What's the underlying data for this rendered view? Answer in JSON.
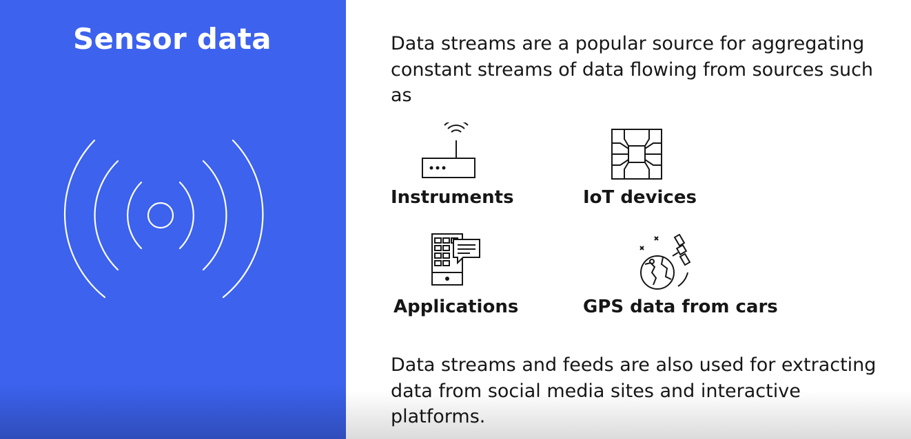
{
  "left_panel": {
    "title": "Sensor data",
    "icon": "sensor-signal-icon",
    "background_color": "#3c62ee"
  },
  "right_panel": {
    "intro_text": "Data streams are a popular source for aggregating constant streams of data flowing from sources such as",
    "sources": [
      {
        "label": "Instruments",
        "icon": "router-icon"
      },
      {
        "label": "IoT devices",
        "icon": "chip-icon"
      },
      {
        "label": "Applications",
        "icon": "mobile-app-icon"
      },
      {
        "label": "GPS data from cars",
        "icon": "satellite-globe-icon"
      }
    ],
    "outro_text": "Data streams and feeds are also used for extracting data from social media sites and interactive platforms."
  }
}
